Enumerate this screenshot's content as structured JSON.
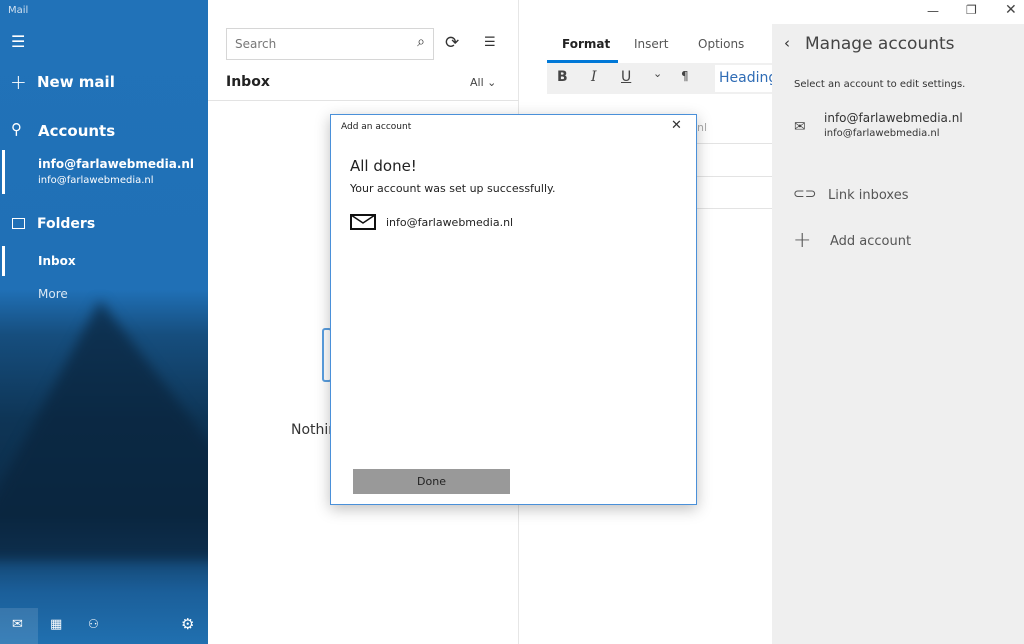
{
  "app": {
    "title": "Mail"
  },
  "sidebar": {
    "new_mail": "New mail",
    "accounts_label": "Accounts",
    "account": {
      "name": "info@farlawebmedia.nl",
      "email": "info@farlawebmedia.nl"
    },
    "folders_label": "Folders",
    "folders": [
      {
        "label": "Inbox"
      },
      {
        "label": "More"
      }
    ]
  },
  "list": {
    "search_placeholder": "Search",
    "title": "Inbox",
    "filter": "All",
    "empty_text": "Nothin"
  },
  "compose": {
    "tabs": [
      {
        "label": "Format",
        "active": true
      },
      {
        "label": "Insert"
      },
      {
        "label": "Options"
      }
    ],
    "bold": "B",
    "italic": "I",
    "underline": "U",
    "style": "Heading",
    "partial_text": "nl"
  },
  "manage": {
    "title": "Manage accounts",
    "subtitle": "Select an account to edit settings.",
    "account": {
      "name": "info@farlawebmedia.nl",
      "email": "info@farlawebmedia.nl"
    },
    "link_inboxes": "Link inboxes",
    "add_account": "Add account"
  },
  "dialog": {
    "title": "Add an account",
    "heading": "All done!",
    "message": "Your account was set up successfully.",
    "account_email": "info@farlawebmedia.nl",
    "done_label": "Done"
  },
  "colors": {
    "accent": "#0078d7",
    "sidebar": "#2070b6",
    "done_button": "#999999"
  }
}
